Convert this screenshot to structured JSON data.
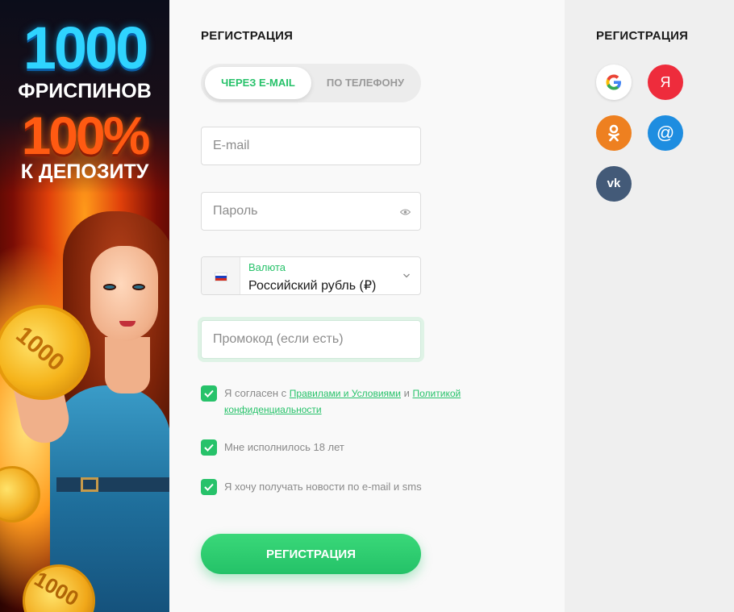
{
  "banner": {
    "line1": "1000",
    "line2": "ФРИСПИНОВ",
    "line3": "100%",
    "line4": "К ДЕПОЗИТУ",
    "coin_text": "1000",
    "colors": {
      "cyan": "#2fd4ff",
      "orange": "#ff5a12"
    }
  },
  "form": {
    "title": "РЕГИСТРАЦИЯ",
    "tabs": [
      {
        "label": "ЧЕРЕЗ E-MAIL",
        "active": true
      },
      {
        "label": "ПО ТЕЛЕФОНУ",
        "active": false
      }
    ],
    "email": {
      "placeholder": "E-mail",
      "value": ""
    },
    "password": {
      "placeholder": "Пароль",
      "value": "",
      "icon": "eye-icon"
    },
    "currency": {
      "label": "Валюта",
      "value": "Российский рубль (₽)",
      "flag": "russia-flag-icon"
    },
    "promo": {
      "placeholder": "Промокод (если есть)",
      "value": ""
    },
    "checkboxes": [
      {
        "checked": true,
        "text_before": "Я согласен с ",
        "link1": "Правилами и Условиями",
        "text_mid": " и ",
        "link2": "Политикой конфиденциальности"
      },
      {
        "checked": true,
        "text": "Мне исполнилось 18 лет"
      },
      {
        "checked": true,
        "text": "Я хочу получать новости по e-mail и sms"
      }
    ],
    "submit_label": "РЕГИСТРАЦИЯ",
    "accent_color": "#27c26a"
  },
  "social": {
    "title": "РЕГИСТРАЦИЯ",
    "providers": [
      {
        "name": "google",
        "icon": "google-icon",
        "glyph": "G"
      },
      {
        "name": "yandex",
        "icon": "yandex-icon",
        "glyph": "Я"
      },
      {
        "name": "odnoklassniki",
        "icon": "ok-icon"
      },
      {
        "name": "mail.ru",
        "icon": "at-icon",
        "glyph": "@"
      },
      {
        "name": "vk",
        "icon": "vk-icon",
        "glyph": "vk"
      }
    ]
  }
}
